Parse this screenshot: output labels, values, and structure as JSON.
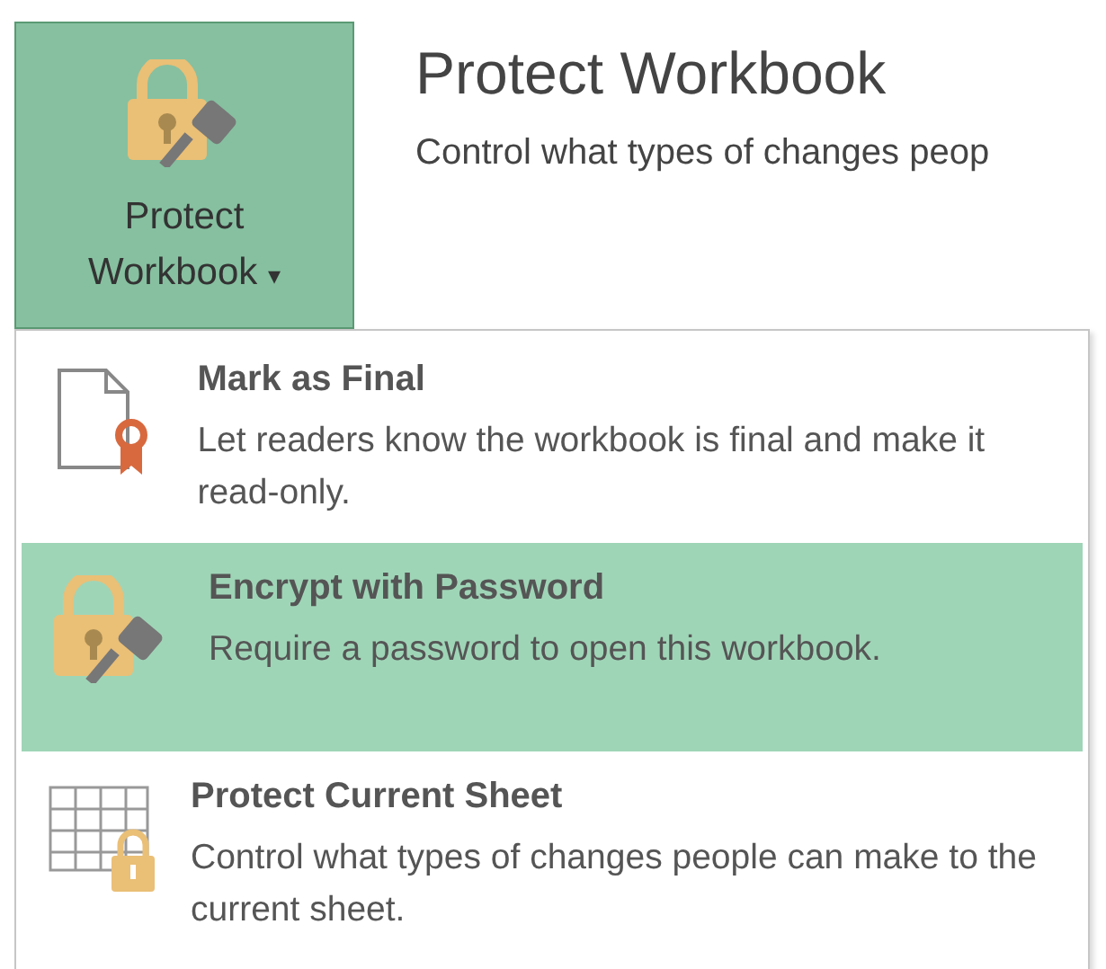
{
  "ribbon_button": {
    "label_line_1": "Protect",
    "label_line_2": "Workbook",
    "caret": "▾",
    "expanded": true
  },
  "header": {
    "title": "Protect Workbook",
    "description": "Control what types of changes peop"
  },
  "menu": {
    "items": [
      {
        "kind": "final",
        "title": "Mark as Final",
        "description": "Let readers know the workbook is final and make it read-only.",
        "selected": false
      },
      {
        "kind": "encrypt",
        "title": "Encrypt with Password",
        "description": "Require a password to open this workbook.",
        "selected": true
      },
      {
        "kind": "sheet",
        "title": "Protect Current Sheet",
        "description": "Control what types of changes people can make to the current sheet.",
        "selected": false
      }
    ]
  }
}
